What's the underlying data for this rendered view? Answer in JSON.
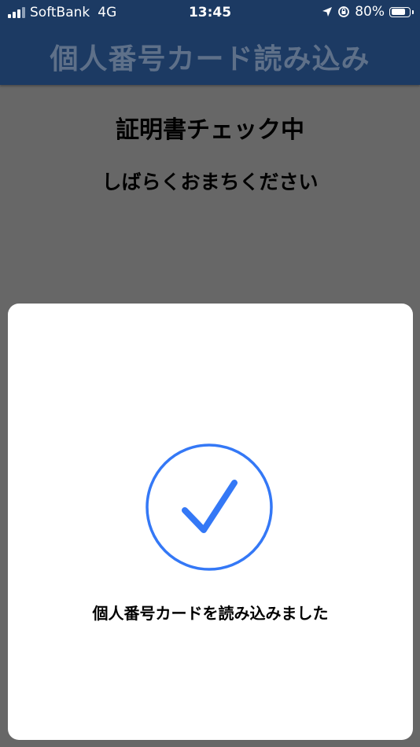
{
  "status_bar": {
    "carrier": "SoftBank",
    "network": "4G",
    "time": "13:45",
    "battery_percent": "80%",
    "battery_level": 0.8,
    "icons": [
      "signal-bars-icon",
      "location-arrow-icon",
      "orientation-lock-icon",
      "battery-icon"
    ]
  },
  "nav": {
    "title": "個人番号カード読み込み"
  },
  "main": {
    "heading": "証明書チェック中",
    "subheading": "しばらくおまちください"
  },
  "sheet": {
    "icon": "checkmark-circle-icon",
    "message": "個人番号カードを読み込みました",
    "accent_color": "#3478f6"
  },
  "colors": {
    "nav_background": "#1c3a63",
    "overlay_background": "#676767",
    "sheet_background": "#ffffff"
  }
}
